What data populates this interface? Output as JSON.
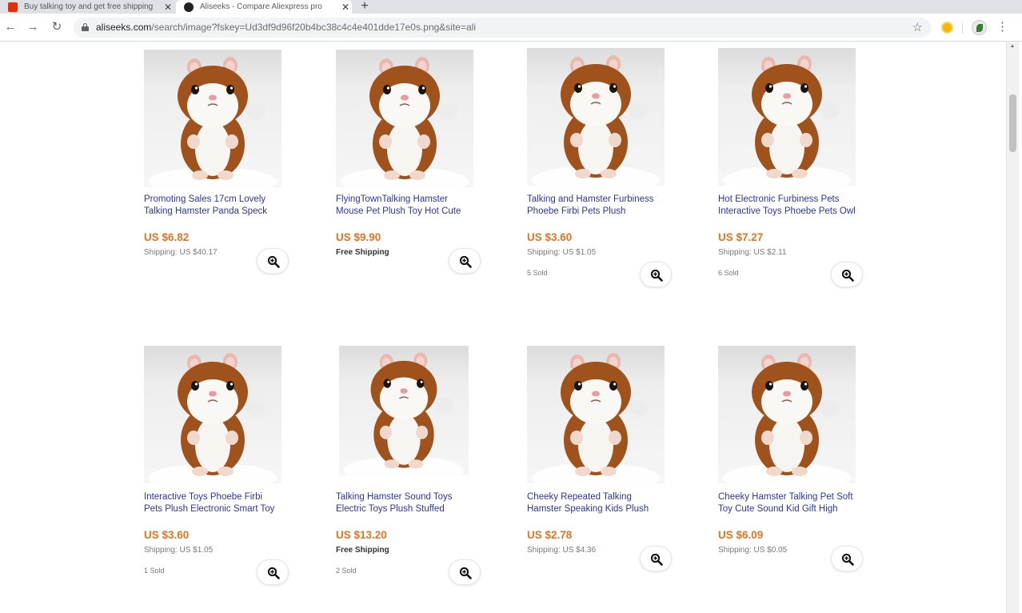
{
  "browser": {
    "tabs": [
      {
        "title": "Buy talking toy and get free shipping",
        "active": false,
        "favicon": "aliexpress-icon"
      },
      {
        "title": "Aliseeks - Compare Aliexpress pro",
        "active": true,
        "favicon": "aliseeks-icon"
      }
    ],
    "new_tab_symbol": "+",
    "url_host": "aliseeks.com",
    "url_rest": "/search/image?fskey=Ud3df9d96f20b4bc38c4c4e401dde17e0s.png&site=ali"
  },
  "products": [
    {
      "title": "Promoting Sales 17cm Lovely\nTalking Hamster Panda Speck",
      "price": "US $6.82",
      "shipping": "Shipping: US $40.17",
      "free_shipping": false,
      "sold": ""
    },
    {
      "title": "FlyingTownTalking Hamster\nMouse Pet Plush Toy Hot Cute",
      "price": "US $9.90",
      "shipping": "Free Shipping",
      "free_shipping": true,
      "sold": ""
    },
    {
      "title": "Talking and Hamster Furbiness\nPhoebe Firbi Pets Plush",
      "price": "US $3.60",
      "shipping": "Shipping: US $1.05",
      "free_shipping": false,
      "sold": "5 Sold"
    },
    {
      "title": "Hot Electronic Furbiness Pets\nInteractive Toys Phoebe Pets Owl",
      "price": "US $7.27",
      "shipping": "Shipping: US $2.11",
      "free_shipping": false,
      "sold": "6 Sold"
    },
    {
      "title": "Interactive Toys Phoebe Firbi\nPets Plush Electronic Smart Toy",
      "price": "US $3.60",
      "shipping": "Shipping: US $1.05",
      "free_shipping": false,
      "sold": "1 Sold"
    },
    {
      "title": "Talking Hamster Sound Toys\nElectric Toys Plush Stuffed",
      "price": "US $13.20",
      "shipping": "Free Shipping",
      "free_shipping": true,
      "sold": "2 Sold"
    },
    {
      "title": "Cheeky Repeated Talking\nHamster Speaking Kids Plush",
      "price": "US $2.78",
      "shipping": "Shipping: US $4.36",
      "free_shipping": false,
      "sold": ""
    },
    {
      "title": "Cheeky Hamster Talking Pet Soft\nToy Cute Sound Kid Gift High",
      "price": "US $6.09",
      "shipping": "Shipping: US $0.05",
      "free_shipping": false,
      "sold": ""
    }
  ],
  "icons": {
    "zoom": "magnifier-plus-icon",
    "back": "back-arrow-icon",
    "forward": "forward-arrow-icon",
    "reload": "reload-icon",
    "bookmark": "star-icon",
    "menu": "kebab-menu-icon"
  },
  "colors": {
    "price": "#e8731f",
    "title_link": "#2b35a6",
    "hamster_fur": "#a0521d"
  }
}
